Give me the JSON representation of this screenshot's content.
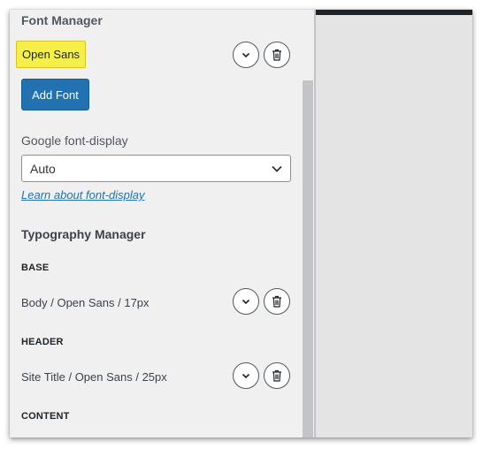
{
  "font_manager": {
    "title": "Font Manager",
    "fonts": [
      {
        "name": "Open Sans"
      }
    ],
    "add_font_label": "Add Font"
  },
  "font_display": {
    "label": "Google font-display",
    "selected": "Auto",
    "learn_link": "Learn about font-display"
  },
  "typography_manager": {
    "title": "Typography Manager",
    "groups": [
      {
        "label": "BASE",
        "item": "Body / Open Sans / 17px"
      },
      {
        "label": "HEADER",
        "item": "Site Title / Open Sans / 25px"
      },
      {
        "label": "CONTENT"
      }
    ]
  },
  "icons": {
    "expand": "chevron-down-icon",
    "delete": "trash-icon",
    "select": "chevron-down-icon"
  },
  "colors": {
    "accent": "#2271b1",
    "highlight": "#f6ef49",
    "panel_bg": "#f0f0f1",
    "preview_bg": "#e4e4e4"
  }
}
